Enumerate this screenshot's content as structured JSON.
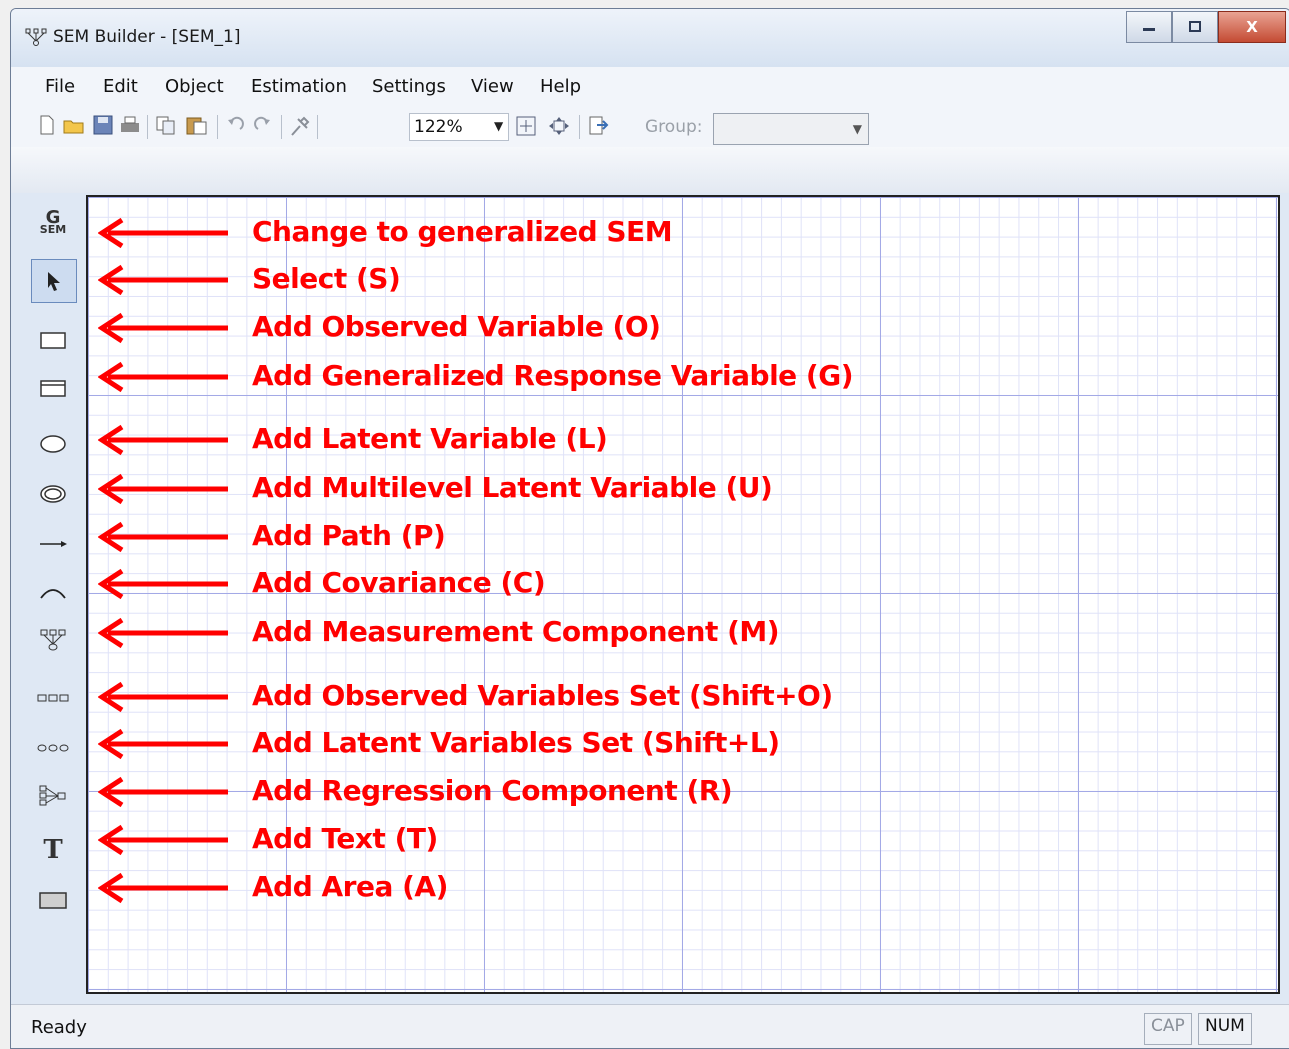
{
  "window": {
    "title": "SEM Builder - [SEM_1]",
    "app_icon": "measurement-component-icon"
  },
  "window_buttons": {
    "minimize": "minimize-icon",
    "maximize": "maximize-icon",
    "close": "close-icon",
    "close_glyph": "X"
  },
  "menu": [
    "File",
    "Edit",
    "Object",
    "Estimation",
    "Settings",
    "View",
    "Help"
  ],
  "toolbar": {
    "zoom_value": "122%",
    "group_label": "Group:",
    "group_value": "",
    "icons": [
      "new-file-icon",
      "open-folder-icon",
      "save-icon",
      "print-icon",
      "copy-icon",
      "paste-icon",
      "undo-icon",
      "redo-icon",
      "pin-icon",
      "fit-to-window-icon",
      "center-view-icon",
      "export-icon"
    ]
  },
  "tools": [
    {
      "icon": "gsem-icon",
      "g": "G",
      "sem": "SEM"
    },
    {
      "icon": "select-arrow-icon",
      "glyph": "➤"
    },
    {
      "icon": "rectangle-icon",
      "glyph": ""
    },
    {
      "icon": "generalized-rectangle-icon",
      "glyph": ""
    },
    {
      "icon": "ellipse-icon",
      "glyph": ""
    },
    {
      "icon": "double-ellipse-icon",
      "glyph": ""
    },
    {
      "icon": "path-arrow-icon",
      "glyph": "⟶"
    },
    {
      "icon": "covariance-arc-icon",
      "glyph": "⌒"
    },
    {
      "icon": "measurement-component-icon",
      "glyph": "⩩"
    },
    {
      "icon": "observed-set-icon",
      "glyph": "▭▭▭"
    },
    {
      "icon": "latent-set-icon",
      "glyph": "ooo"
    },
    {
      "icon": "regression-component-icon",
      "glyph": "⊳"
    },
    {
      "icon": "text-icon",
      "glyph": "T"
    },
    {
      "icon": "area-icon",
      "glyph": ""
    }
  ],
  "annotations": [
    "Change to generalized SEM",
    "Select (S)",
    "Add Observed Variable (O)",
    "Add Generalized Response Variable (G)",
    "Add Latent Variable (L)",
    "Add Multilevel Latent Variable (U)",
    "Add Path (P)",
    "Add Covariance (C)",
    "Add Measurement Component (M)",
    "Add Observed Variables Set (Shift+O)",
    "Add Latent Variables Set (Shift+L)",
    "Add Regression Component (R)",
    "Add Text (T)",
    "Add Area (A)"
  ],
  "annotation_color": "#ff0000",
  "status": {
    "text": "Ready",
    "cap": "CAP",
    "num": "NUM"
  }
}
